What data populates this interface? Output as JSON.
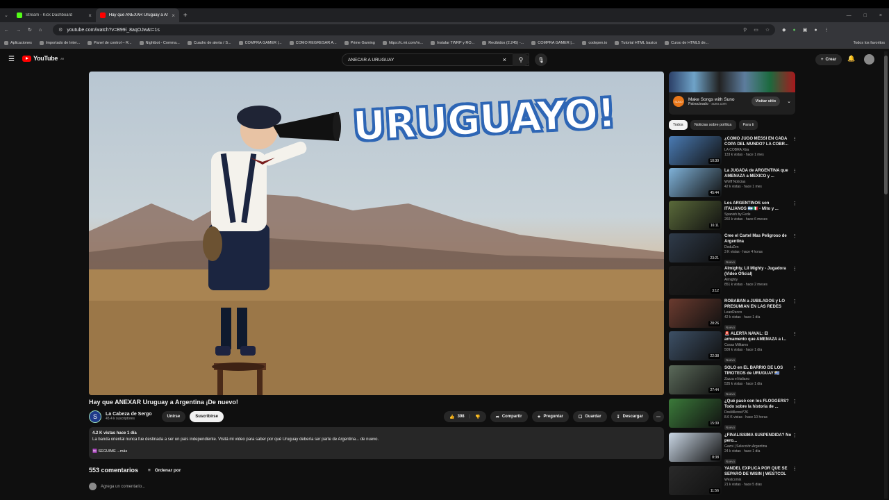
{
  "browser": {
    "tabs": [
      {
        "title": "Stream - Kick Dashboard",
        "active": false,
        "favicon_color": "#53fc18"
      },
      {
        "title": "Hay que ANEXAR Uruguay a Ar...",
        "active": true,
        "favicon_color": "#ff0000"
      }
    ],
    "new_tab": "+",
    "url": "youtube.com/watch?v=B99i_8aqOJw&t=1s",
    "bookmarks": [
      "Aplicaciones",
      "Importado de Inter...",
      "Panel de control – R...",
      "Nightbot - Comma...",
      "Cuadro de alerta / S...",
      "COMPRA GAMER |...",
      "COMO REGRESAR A...",
      "Prime Gaming",
      "https://c.mi.com/m...",
      "Instalar TWRP y RO...",
      "Recibidos (2.245) -...",
      "COMPRA GAMER |...",
      "codepen.io",
      "Tutorial HTML basico",
      "Curso de HTML5 de..."
    ],
    "all_favorites": "Todos los favoritos"
  },
  "header": {
    "logo": "YouTube",
    "country": "AR",
    "search_value": "ANECAR A URUGUAY",
    "create": "Crear"
  },
  "video": {
    "overlay_text": "URUGUAYO!",
    "title": "Hay que ANEXAR Uruguay a Argentina ¡De nuevo!",
    "channel": "La Cabeza de Sergo",
    "channel_initial": "S",
    "subscribers": "45.4 k suscriptores",
    "join": "Unirse",
    "subscribe": "Suscribirse",
    "likes": "398",
    "share": "Compartir",
    "ask": "Preguntar",
    "save": "Guardar",
    "download": "Descargar",
    "meta": "4.2 K vistas  hace 1 día",
    "description": "La banda oriental nunca fue destinada a ser un país independiente. Visitá mi video para saber por qué Uruguay debería ser parte de Argentina... de nuevo.",
    "more": "♾️ SEGUIME  ...más"
  },
  "comments": {
    "count": "553 comentarios",
    "sort": "Ordenar por",
    "placeholder": "Agrega un comentario..."
  },
  "ad": {
    "title": "Make Songs with Suno",
    "sponsored": "Patrocinado",
    "domain": "suno.com",
    "visit": "Visitar sitio",
    "logo_text": "SUNO"
  },
  "chips": [
    "Todos",
    "Noticias sobre política",
    "Para ti"
  ],
  "recommendations": [
    {
      "title": "¿CÓMO JUGÓ MESSI EN CADA COPA DEL MUNDO? LA COBR...",
      "channel": "LA COBRA Xtra",
      "meta": "133 k vistas · hace 1 mes",
      "duration": "10:30",
      "badge": "",
      "thumb_color": "#4a7bb4"
    },
    {
      "title": "La JUGADA de ARGENTINA que AMENAZA a MEXICO y ...",
      "channel": "Wolff Noticias",
      "meta": "42 k vistas · hace 1 mes",
      "duration": "45:44",
      "badge": "",
      "thumb_color": "#7fb2d9"
    },
    {
      "title": "Los ARGENTINOS son ITALIANOS 🇦🇷🇮🇹 - Mito y ...",
      "channel": "Spanish by Fede",
      "meta": "260 k vistas · hace 6 meses",
      "duration": "16:11",
      "badge": "",
      "thumb_color": "#5a6a3a"
    },
    {
      "title": "Cree el Cartel Mas Peligroso de Argentina",
      "channel": "DoduZen",
      "meta": "3 K vistas · hace 4 horas",
      "duration": "23:21",
      "badge": "Nuevo",
      "thumb_color": "#2f3b4a"
    },
    {
      "title": "Almighty, Lil Mighty - Jugadora (Video Oficial)",
      "channel": "Almighty",
      "meta": "851 k vistas · hace 2 meses",
      "duration": "3:12",
      "badge": "",
      "thumb_color": "#1c1c1c"
    },
    {
      "title": "ROBABAN a JUBILADOS y LO PRESUMIAN EN LAS REDES",
      "channel": "LeanRecco",
      "meta": "42 k vistas · hace 1 día",
      "duration": "28:26",
      "badge": "Nuevo",
      "thumb_color": "#6b3b2f"
    },
    {
      "title": "🚨 ALERTA NAVAL: El armamento que AMENAZA a l...",
      "channel": "Cosas Militares",
      "meta": "509 k vistas · hace 1 día",
      "duration": "22:38",
      "badge": "Nuevo",
      "thumb_color": "#3d5066"
    },
    {
      "title": "SOLO en EL BARRIO DE LOS TIROTEOS de URUGUAY 🇺🇾",
      "channel": "Zazza el italiano",
      "meta": "535 k vistas · hace 1 día",
      "duration": "27:44",
      "badge": "Nuevo",
      "thumb_color": "#5b6a5a"
    },
    {
      "title": "¿Qué pasó con los FLOGGERS? Todo sobre la historia de ...",
      "channel": "DosMilerosY2K",
      "meta": "8.6 K vistas · hace 10 horas",
      "duration": "15:39",
      "badge": "Nuevo",
      "thumb_color": "#3b7a3a"
    },
    {
      "title": "¿FINALISSIMA SUSPENDIDA? No pero...",
      "channel": "Gazoi | Selección Argentina",
      "meta": "24 k vistas · hace 1 día",
      "duration": "8:38",
      "badge": "Nuevo",
      "thumb_color": "#c9d6e4"
    },
    {
      "title": "YANDEL EXPLICA POR QUÉ SE SEPARÓ DE WISIN | WESTCOL",
      "channel": "Westcomix",
      "meta": "21 k vistas · hace 5 días",
      "duration": "11:56",
      "badge": "",
      "thumb_color": "#2a2a2a"
    }
  ]
}
